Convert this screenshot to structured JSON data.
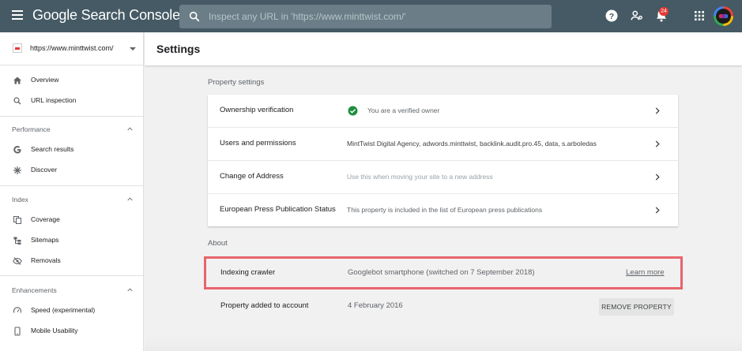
{
  "header": {
    "brand": "Google Search Console",
    "search_placeholder": "Inspect any URL in 'https://www.minttwist.com/'",
    "notification_count": "24"
  },
  "sidebar": {
    "property_url": "https://www.minttwist.com/",
    "top_items": [
      {
        "label": "Overview",
        "icon": "home-icon"
      },
      {
        "label": "URL inspection",
        "icon": "search-icon"
      }
    ],
    "sections": [
      {
        "title": "Performance",
        "items": [
          {
            "label": "Search results",
            "icon": "google-g-icon"
          },
          {
            "label": "Discover",
            "icon": "asterisk-icon"
          }
        ]
      },
      {
        "title": "Index",
        "items": [
          {
            "label": "Coverage",
            "icon": "coverage-icon"
          },
          {
            "label": "Sitemaps",
            "icon": "sitemap-icon"
          },
          {
            "label": "Removals",
            "icon": "removals-icon"
          }
        ]
      },
      {
        "title": "Enhancements",
        "items": [
          {
            "label": "Speed (experimental)",
            "icon": "speedometer-icon"
          },
          {
            "label": "Mobile Usability",
            "icon": "phone-icon"
          }
        ]
      }
    ]
  },
  "main": {
    "page_title": "Settings",
    "property_settings_label": "Property settings",
    "property_settings": [
      {
        "name": "Ownership verification",
        "value": "You are a verified owner"
      },
      {
        "name": "Users and permissions",
        "value": "MintTwist Digital Agency, adwords.minttwist, backlink.audit.pro.45, data, s.arboledas"
      },
      {
        "name": "Change of Address",
        "value": "Use this when moving your site to a new address"
      },
      {
        "name": "European Press Publication Status",
        "value": "This property is included in the list of European press publications"
      }
    ],
    "about_label": "About",
    "about": [
      {
        "name": "Indexing crawler",
        "value": "Googlebot smartphone (switched on 7 September 2018)",
        "action": "Learn more"
      },
      {
        "name": "Property added to account",
        "value": "4 February 2016",
        "action": "REMOVE PROPERTY"
      }
    ]
  },
  "colors": {
    "header_bg": "#455a64",
    "highlight": "#e8646b",
    "verified_green": "#1e8e3e",
    "notification_badge": "#e53935"
  }
}
